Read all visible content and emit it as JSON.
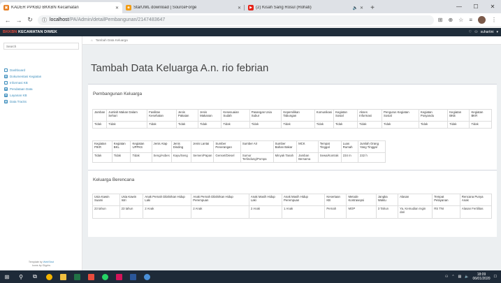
{
  "browser": {
    "tabs": [
      {
        "title": "KADER PPKBD BKKBN Kecamatan",
        "favicon_color": "#e67e22",
        "active": true
      },
      {
        "title": "StarUML download | SourceForge",
        "favicon_color": "#f39c12",
        "active": false
      },
      {
        "title": "(2) Kisah Sang Rosul (Rohati)",
        "favicon_color": "#e62117",
        "active": false
      }
    ],
    "new_tab": "+",
    "url_host": "localhost",
    "url_path": "/PA/Admin/detailPembangunan/2147483647",
    "info_icon": "ⓘ",
    "window_controls": [
      "—",
      "☐",
      "✕"
    ]
  },
  "app": {
    "brand_prefix": "BKKBN",
    "brand_suffix": "KECAMATAN DIWEK",
    "user": "suhartini"
  },
  "sidebar": {
    "search_placeholder": "Search",
    "menu": [
      {
        "label": "Dashboard",
        "icon": "dashboard-icon"
      },
      {
        "label": "Dokumentasi Kegiatan",
        "icon": "document-icon"
      },
      {
        "label": "Informasi KB",
        "icon": "info-icon"
      },
      {
        "label": "Pendataan Data",
        "icon": "data-icon"
      },
      {
        "label": "Layanan KB",
        "icon": "service-icon"
      },
      {
        "label": "Data Tracks",
        "icon": "tracks-icon"
      }
    ],
    "footer_line1_prefix": "Template by",
    "footer_line1_link": "WebStrot",
    "footer_line2": "Icons by Glyphs"
  },
  "content": {
    "breadcrumb": "Tambah Data Keluarga",
    "page_title": "Tambah Data Keluarga A.n. rio febrian",
    "pembangunan": {
      "title": "Pembangunan Keluarga",
      "table1": {
        "headers": [
          "Jamban",
          "Jumlah Makan Dalam Sehari",
          "Fasilitas Kesehatan",
          "Jenis Pakaian",
          "Jenis Makanan",
          "Kesesuaian Sudah",
          "Pasangan Usia Subur",
          "Kepemilikan Tabungan",
          "Komunikasi",
          "Kegiatan Sosial",
          "Akses Informasi",
          "Pengurus Kegiatan Sosial",
          "Kegiatan Posyandu",
          "Kegiatan BKB",
          "Kegiatan BKR"
        ],
        "row": [
          "Tidak",
          "Tidak",
          "Tidak",
          "Tidak",
          "Tidak",
          "Tidak",
          "Tidak",
          "Tidak",
          "Tidak",
          "Tidak",
          "Tidak",
          "Tidak",
          "Tidak",
          "Tidak",
          "Tidak"
        ]
      },
      "table2": {
        "headers": [
          "Kegiatan PIKR",
          "Kegiatan BKL",
          "Kegiatan UPPKS",
          "Jenis Atap",
          "Jenis Dinding",
          "Jenis Lantai",
          "Sumber Penerangan",
          "Sumber Air",
          "Sumber Bahan Bakar",
          "MCK",
          "Tempat Tinggal",
          "Luas Rumah",
          "Jumlah Orang Yang Tinggal"
        ],
        "row": [
          "Tidak",
          "Tidak",
          "Tidak",
          "Seng/Asbes",
          "Kayu/Seng",
          "Semen/Papan",
          "Genset/Diesel",
          "Sumur Terlindung/Pompa",
          "Minyak Tanah",
          "Jamban Bersama",
          "Sewa/Kontrak",
          "234 m",
          "232 h"
        ]
      }
    },
    "keluarga_berencana": {
      "title": "Keluarga Berencana",
      "headers": [
        "Usia Kawin Suami",
        "Usia Kawin Istri",
        "Anak Pernah Dilahirkan Hidup Laki",
        "Anak Pernah Dilahirkan Hidup Perempuan",
        "Anak Masih Hidup Laki",
        "Anak Masih Hidup Perempuan",
        "Kesertaan KB",
        "Metode Kontrasepsi",
        "Jangka Waktu",
        "Alasan",
        "Tempat Pelayanan",
        "Rencana Punya Anak"
      ],
      "row": [
        "23 tahun",
        "23 tahun",
        "2 Anak",
        "2 Anak",
        "2 Anak",
        "1 Anak",
        "Pernah",
        "MOP",
        "3 Tahun",
        "Ya, Kemudian Ingin dari",
        "RS TNI",
        "Alasan Fertilitas"
      ]
    }
  },
  "taskbar": {
    "clock_time": "18:09",
    "clock_date": "06/01/2020"
  }
}
